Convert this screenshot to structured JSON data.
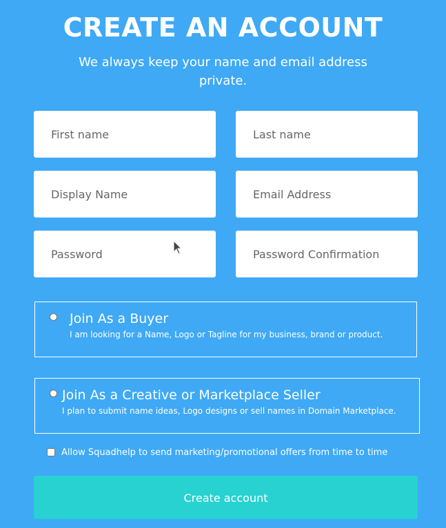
{
  "header": {
    "title": "CREATE AN ACCOUNT",
    "subtitle": "We always keep your name and email address private."
  },
  "form": {
    "first_name": {
      "placeholder": "First name",
      "value": ""
    },
    "last_name": {
      "placeholder": "Last name",
      "value": ""
    },
    "display_name": {
      "placeholder": "Display Name",
      "value": ""
    },
    "email": {
      "placeholder": "Email Address",
      "value": ""
    },
    "password": {
      "placeholder": "Password",
      "value": ""
    },
    "password_confirmation": {
      "placeholder": "Password Confirmation",
      "value": ""
    }
  },
  "roles": {
    "buyer": {
      "title": "Join As a Buyer",
      "description": "I am looking for a Name, Logo or Tagline for my business, brand or product.",
      "selected": false
    },
    "seller": {
      "title": "Join As a Creative or Marketplace Seller",
      "description": "I plan to submit name ideas, Logo designs or sell names in Domain Marketplace.",
      "selected": false
    }
  },
  "marketing_opt_in": {
    "label": "Allow Squadhelp to send marketing/promotional offers from time to time",
    "checked": false
  },
  "submit": {
    "label": "Create account"
  },
  "colors": {
    "background": "#3fa9f5",
    "button": "#28d2d0",
    "field": "#ffffff"
  }
}
